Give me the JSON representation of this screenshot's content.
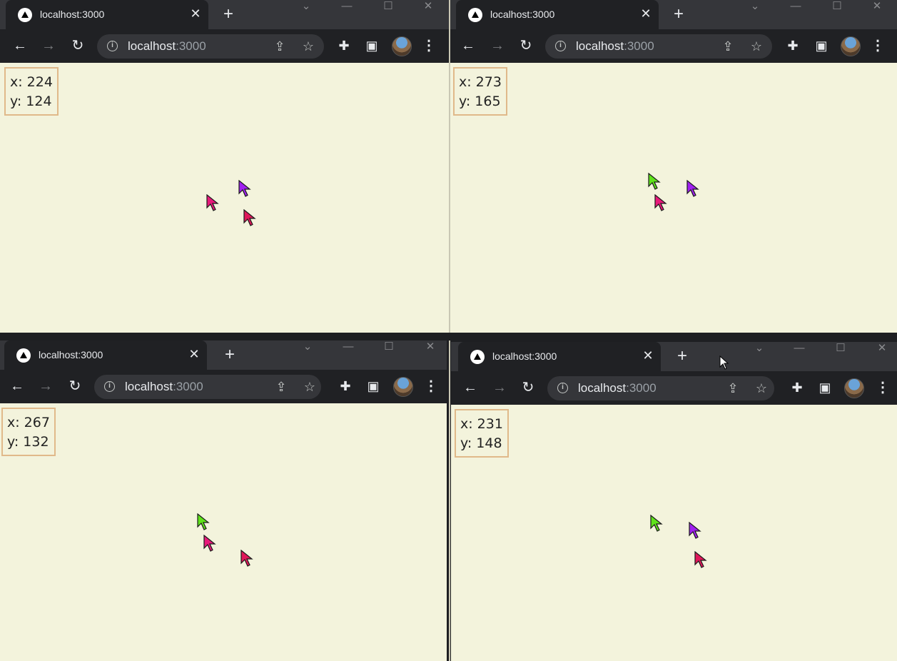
{
  "windows": [
    {
      "tab_title": "localhost:3000",
      "url_host": "localhost",
      "url_port": ":3000",
      "coords_x": "x: 224",
      "coords_y": "y: 124",
      "cursors": [
        "purple",
        "pink",
        "crimson"
      ]
    },
    {
      "tab_title": "localhost:3000",
      "url_host": "localhost",
      "url_port": ":3000",
      "coords_x": "x: 273",
      "coords_y": "y: 165",
      "cursors": [
        "green",
        "purple",
        "pink"
      ]
    },
    {
      "tab_title": "localhost:3000",
      "url_host": "localhost",
      "url_port": ":3000",
      "coords_x": "x: 267",
      "coords_y": "y: 132",
      "cursors": [
        "green",
        "pink",
        "crimson"
      ]
    },
    {
      "tab_title": "localhost:3000",
      "url_host": "localhost",
      "url_port": ":3000",
      "coords_x": "x: 231",
      "coords_y": "y: 148",
      "cursors": [
        "green",
        "purple",
        "crimson"
      ]
    }
  ],
  "icons": {
    "tab_close": "✕",
    "new_tab": "+",
    "minimize": "—",
    "maximize": "☐",
    "close": "✕",
    "dropdown": "⌄",
    "back": "←",
    "forward": "→",
    "reload": "↻",
    "share": "⇪",
    "star": "☆",
    "extensions": "✚",
    "sidepanel": "▣",
    "menu": "⋮",
    "info": "i"
  },
  "colors": {
    "page_bg": "#f3f3dc",
    "coords_border": "#e0b98a",
    "cursor_green": "#5fe21a",
    "cursor_purple": "#a020f0",
    "cursor_pink": "#e8197a",
    "cursor_crimson": "#e0175a"
  }
}
